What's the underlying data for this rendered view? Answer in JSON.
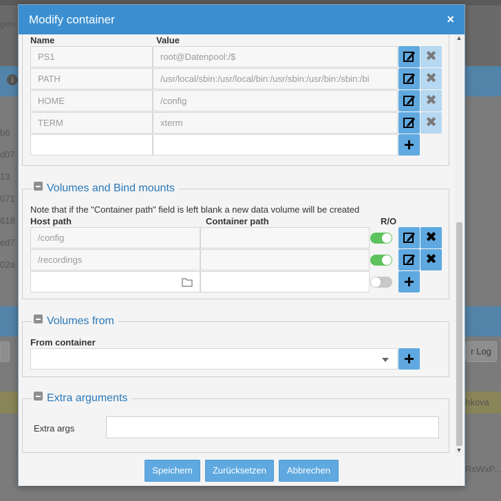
{
  "background": {
    "fragments": [
      "gen",
      "b6",
      "d07",
      "13",
      "071",
      "618",
      "ed7",
      "02a",
      "r Log",
      "hkova",
      "RsWxP..."
    ]
  },
  "modal": {
    "title": "Modify container",
    "close_label": "×"
  },
  "env": {
    "col_name": "Name",
    "col_value": "Value",
    "rows": [
      {
        "name": "PS1",
        "value": "root@Datenpool:/$"
      },
      {
        "name": "PATH",
        "value": "/usr/local/sbin:/usr/local/bin:/usr/sbin:/usr/bin:/sbin:/bi"
      },
      {
        "name": "HOME",
        "value": "/config"
      },
      {
        "name": "TERM",
        "value": "xterm"
      }
    ]
  },
  "volumes": {
    "legend": "Volumes and Bind mounts",
    "note": "Note that if the \"Container path\" field is left blank a new data volume will be created",
    "col_host": "Host path",
    "col_container": "Container path",
    "col_ro": "R/O",
    "rows": [
      {
        "host": "/config",
        "container": "",
        "ro": true
      },
      {
        "host": "/recordings",
        "container": "",
        "ro": true
      }
    ]
  },
  "volumes_from": {
    "legend": "Volumes from",
    "label": "From container",
    "selected": ""
  },
  "extra": {
    "legend": "Extra arguments",
    "label": "Extra args",
    "value": ""
  },
  "footer": {
    "save": "Speichern",
    "reset": "Zurücksetzen",
    "cancel": "Abbrechen"
  },
  "colors": {
    "header": "#3b8fd0",
    "button": "#5fa9e0",
    "legend_text": "#2a78b8",
    "toggle_on": "#5dc35d"
  }
}
